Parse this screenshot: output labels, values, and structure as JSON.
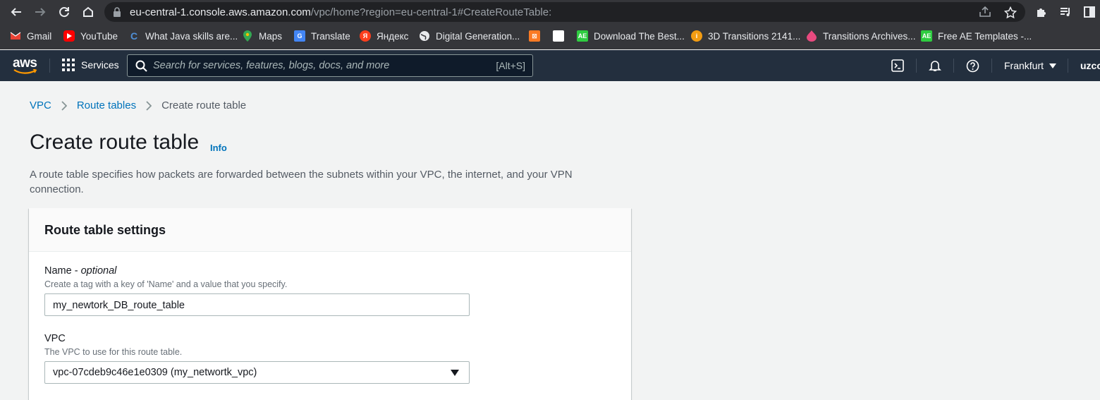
{
  "browser": {
    "url_host": "eu-central-1.console.aws.amazon.com",
    "url_path": "/vpc/home?region=eu-central-1#CreateRouteTable:",
    "bookmarks": [
      {
        "label": "Gmail",
        "icon": "gmail-icon",
        "color": "#ea4335"
      },
      {
        "label": "YouTube",
        "icon": "youtube-icon",
        "color": "#ff0000"
      },
      {
        "label": "What Java skills are...",
        "icon": "c-icon",
        "color": "#4f8fd6"
      },
      {
        "label": "Maps",
        "icon": "maps-icon",
        "color": "#34a853"
      },
      {
        "label": "Translate",
        "icon": "translate-icon",
        "color": "#4285f4"
      },
      {
        "label": "Яндекс",
        "icon": "yandex-icon",
        "color": "#fc3f1d"
      },
      {
        "label": "Digital Generation...",
        "icon": "globe-icon",
        "color": "#e8eaed"
      },
      {
        "label": "",
        "icon": "xampp-icon",
        "color": "#fb7a24"
      },
      {
        "label": "",
        "icon": "blank-page-icon",
        "color": "#ffffff"
      },
      {
        "label": "Download The Best...",
        "icon": "ae-icon",
        "color": "#2ecc40"
      },
      {
        "label": "3D Transitions 2141...",
        "icon": "info-orange-icon",
        "color": "#f39c12"
      },
      {
        "label": "Transitions Archives...",
        "icon": "pink-drop-icon",
        "color": "#e84a7f"
      },
      {
        "label": "Free AE Templates -...",
        "icon": "ae-icon",
        "color": "#2ecc40"
      }
    ]
  },
  "header": {
    "logo_text": "aws",
    "services_label": "Services",
    "search_placeholder": "Search for services, features, blogs, docs, and more",
    "search_hint": "[Alt+S]",
    "region": "Frankfurt",
    "user": "uzco"
  },
  "breadcrumb": {
    "items": [
      "VPC",
      "Route tables",
      "Create route table"
    ]
  },
  "page": {
    "title": "Create route table",
    "info": "Info",
    "description": "A route table specifies how packets are forwarded between the subnets within your VPC, the internet, and your VPN connection."
  },
  "panel": {
    "title": "Route table settings",
    "name_label": "Name -",
    "name_optional": "optional",
    "name_desc": "Create a tag with a key of 'Name' and a value that you specify.",
    "name_value": "my_newtork_DB_route_table",
    "vpc_label": "VPC",
    "vpc_desc": "The VPC to use for this route table.",
    "vpc_value": "vpc-07cdeb9c46e1e0309 (my_networtk_vpc)"
  },
  "colors": {
    "aws_header": "#232f3e",
    "link": "#0073bb",
    "aws_orange": "#ff9900"
  }
}
